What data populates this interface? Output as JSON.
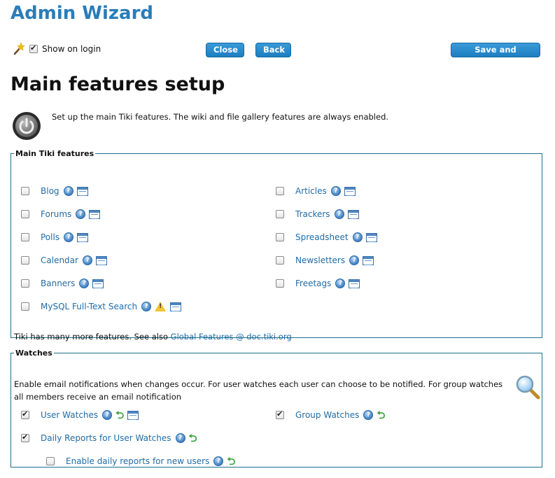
{
  "header": {
    "wizard_title": "Admin Wizard",
    "show_on_login_label": "Show on login",
    "show_on_login_checked": true,
    "close_label": "Close",
    "back_label": "Back",
    "save_continue_label": "Save and Continue"
  },
  "page": {
    "title": "Main features setup",
    "intro": "Set up the main Tiki features. The wiki and file gallery features are always enabled."
  },
  "main_features": {
    "legend": "Main Tiki features",
    "left": [
      {
        "label": "Blog",
        "checked": false
      },
      {
        "label": "Forums",
        "checked": false
      },
      {
        "label": "Polls",
        "checked": false
      },
      {
        "label": "Calendar",
        "checked": false
      },
      {
        "label": "Banners",
        "checked": false
      },
      {
        "label": "MySQL Full-Text Search",
        "checked": false
      }
    ],
    "right": [
      {
        "label": "Articles",
        "checked": false
      },
      {
        "label": "Trackers",
        "checked": false
      },
      {
        "label": "Spreadsheet",
        "checked": false
      },
      {
        "label": "Newsletters",
        "checked": false
      },
      {
        "label": "Freetags",
        "checked": false
      }
    ],
    "more_text": "Tiki has many more features. See also ",
    "more_link": "Global Features @ doc.tiki.org"
  },
  "watches": {
    "legend": "Watches",
    "description": "Enable email notifications when changes occur. For user watches each user can choose to be notified. For group watches all members receive an email notification",
    "user_watches": {
      "label": "User Watches",
      "checked": true
    },
    "group_watches": {
      "label": "Group Watches",
      "checked": true
    },
    "daily_reports": {
      "label": "Daily Reports for User Watches",
      "checked": true
    },
    "daily_reports_new_users": {
      "label": "Enable daily reports for new users",
      "checked": false
    }
  }
}
